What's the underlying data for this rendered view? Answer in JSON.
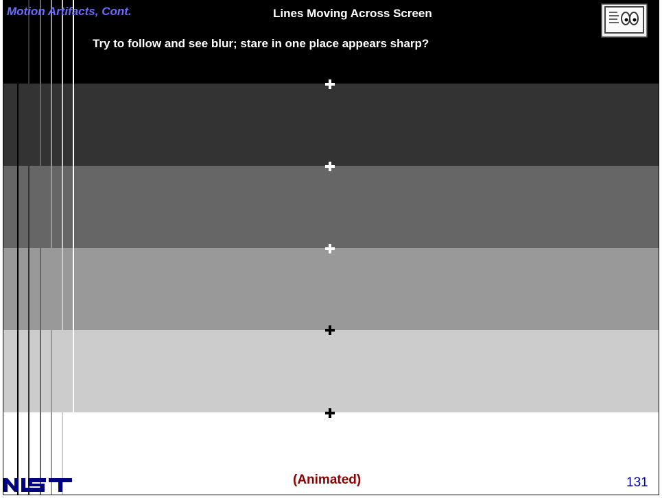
{
  "header": {
    "section": "Motion Artifacts, Cont.",
    "title": "Lines Moving Across Screen",
    "subtitle": "Try to follow and see blur; stare in one place appears sharp?"
  },
  "footer": {
    "note": "(Animated)",
    "page_number": "131",
    "logo_text": "NIST"
  },
  "bands": [
    {
      "color": "#000000"
    },
    {
      "color": "#333333"
    },
    {
      "color": "#666666"
    },
    {
      "color": "#999999"
    },
    {
      "color": "#cccccc"
    },
    {
      "color": "#ffffff"
    }
  ],
  "moving_lines": [
    {
      "color": "#000000"
    },
    {
      "color": "#333333"
    },
    {
      "color": "#666666"
    },
    {
      "color": "#999999"
    },
    {
      "color": "#cccccc"
    },
    {
      "color": "#ffffff"
    }
  ],
  "crosshair_colors": [
    "#ffffff",
    "#ffffff",
    "#ffffff",
    "#000000",
    "#000000"
  ],
  "colors": {
    "section_title": "#6b6bff",
    "note": "#8b0000",
    "page_number": "#0000b0",
    "logo": "#000080"
  },
  "icons": {
    "corner": "framed-eye-icon"
  }
}
